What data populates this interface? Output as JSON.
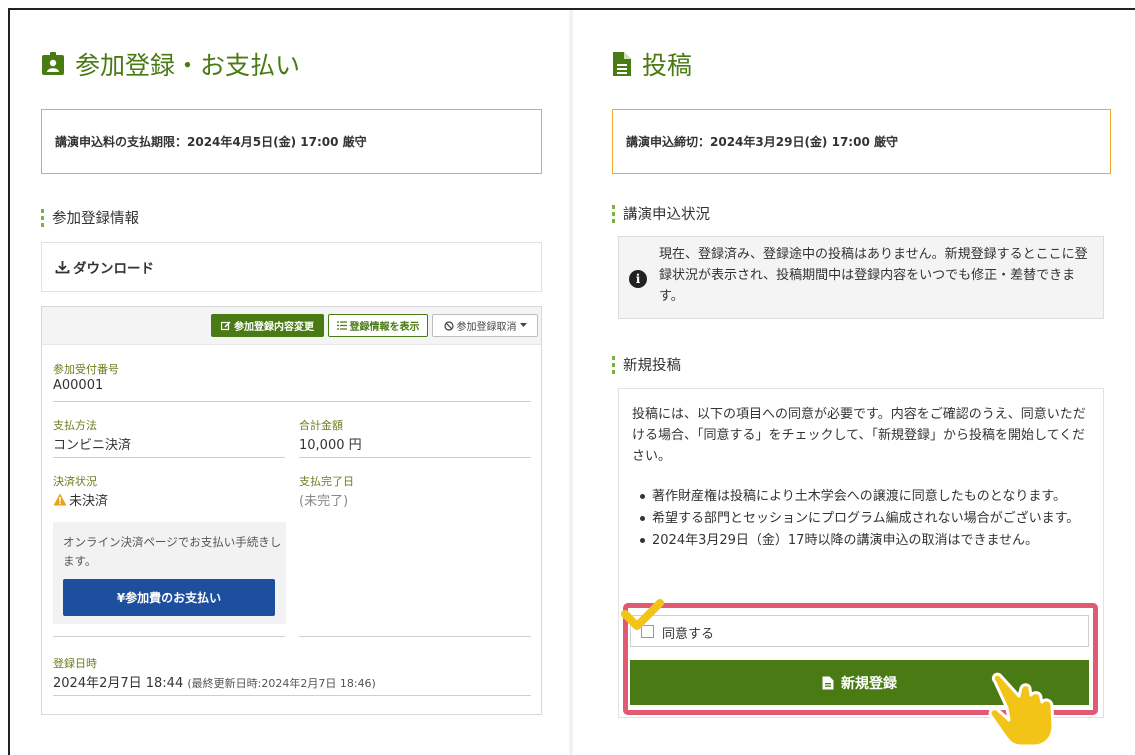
{
  "left": {
    "title": "参加登録・お支払い",
    "deadline": "講演申込料の支払期限：2024年4月5日(金) 17:00 厳守",
    "section_label": "参加登録情報",
    "download_label": "ダウンロード",
    "toolbar": {
      "edit_label": "参加登録内容変更",
      "show_label": "登録情報を表示",
      "cancel_label": "参加登録取消"
    },
    "fields": {
      "reception_number_label": "参加受付番号",
      "reception_number_value": "A00001",
      "payment_method_label": "支払方法",
      "payment_method_value": "コンビニ決済",
      "total_label": "合計金額",
      "total_value": "10,000 円",
      "status_label": "決済状況",
      "status_value": "未決済",
      "completed_label": "支払完了日",
      "completed_value": "(未完了)",
      "registered_label": "登録日時",
      "registered_value": "2024年2月7日 18:44",
      "updated_value": "(最終更新日時:2024年2月7日 18:46)"
    },
    "payment_panel": {
      "text": "オンライン決済ページでお支払い手続きします。",
      "button_label": "¥参加費のお支払い"
    }
  },
  "right": {
    "title": "投稿",
    "deadline": "講演申込締切：2024年3月29日(金) 17:00 厳守",
    "status_section_label": "講演申込状況",
    "info_text": "現在、登録済み、登録途中の投稿はありません。新規登録するとここに登録状況が表示され、投稿期間中は登録内容をいつでも修正・差替できます。",
    "new_section_label": "新規投稿",
    "new_intro": "投稿には、以下の項目への同意が必要です。内容をご確認のうえ、同意いただける場合、「同意する」をチェックして、「新規登録」から投稿を開始してください。",
    "terms": [
      "著作財産権は投稿により土木学会への譲渡に同意したものとなります。",
      "希望する部門とセッションにプログラム編成されない場合がございます。",
      "2024年3月29日（金）17時以降の講演申込の取消はできません。"
    ],
    "agree_label": "同意する",
    "new_button_label": "新規登録"
  },
  "colors": {
    "brand_green": "#4a7a14",
    "deadline_border": "#f0a92e",
    "pay_button": "#1e4e9e",
    "highlight": "#e05a73",
    "annotation_yellow": "#f3c418"
  },
  "icons": [
    "id-badge-icon",
    "document-icon",
    "download-icon",
    "edit-icon",
    "list-icon",
    "ban-icon",
    "caret-down-icon",
    "warning-icon",
    "info-icon",
    "checkmark-annotation-icon",
    "pointing-hand-icon"
  ]
}
